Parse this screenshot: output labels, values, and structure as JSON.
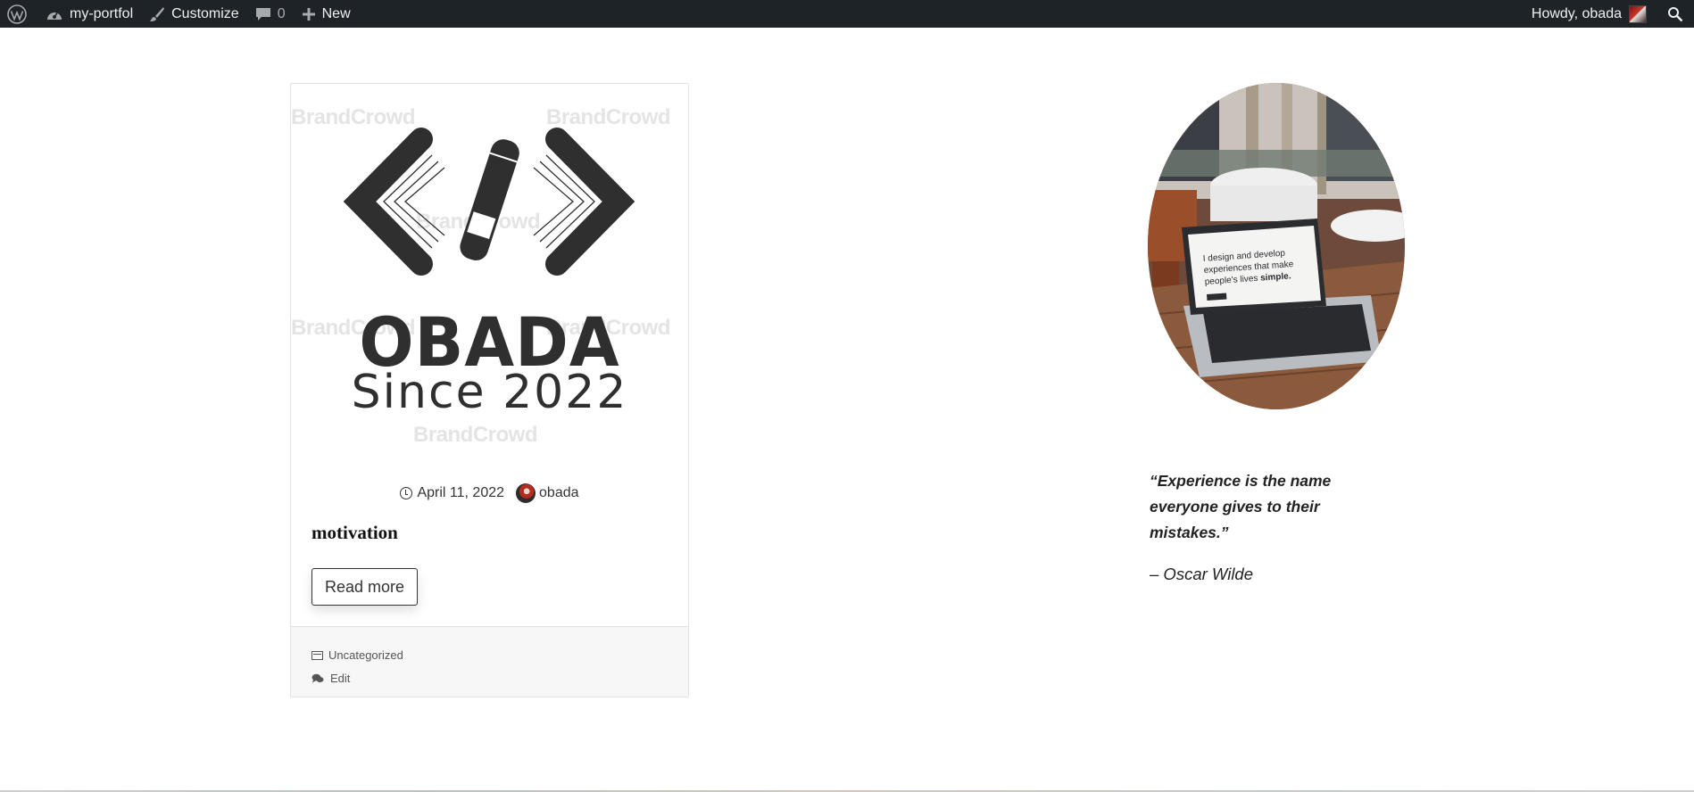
{
  "admin_bar": {
    "site_name": "my-portfol",
    "customize_label": "Customize",
    "comments_count": "0",
    "new_label": "New",
    "greeting": "Howdy, obada"
  },
  "post": {
    "image": {
      "logo_name": "OBADA",
      "logo_tagline": "Since 2022",
      "watermark": "BrandCrowd"
    },
    "date": "April 11, 2022",
    "author": "obada",
    "title": "motivation",
    "read_more_label": "Read more",
    "category": "Uncategorized",
    "edit_label": "Edit"
  },
  "sidebar": {
    "image_alt_text": "I design and develop experiences that make people's lives simple.",
    "quote": "“Experience is the name everyone gives to their mistakes.”",
    "quote_author": "– Oscar Wilde"
  },
  "colors": {
    "admin_bar_bg": "#1d2327",
    "admin_bar_text": "#f0f0f1",
    "logo_dark": "#2f2f2f",
    "card_footer_bg": "#f7f7f7"
  },
  "icons": {
    "wordpress": "wordpress-logo-icon",
    "site": "dashboard-icon",
    "customize": "paintbrush-icon",
    "comments": "comment-bubble-icon",
    "new": "plus-icon",
    "search": "search-icon",
    "date": "clock-icon",
    "category": "folder-icon",
    "edit": "comments-icon"
  }
}
